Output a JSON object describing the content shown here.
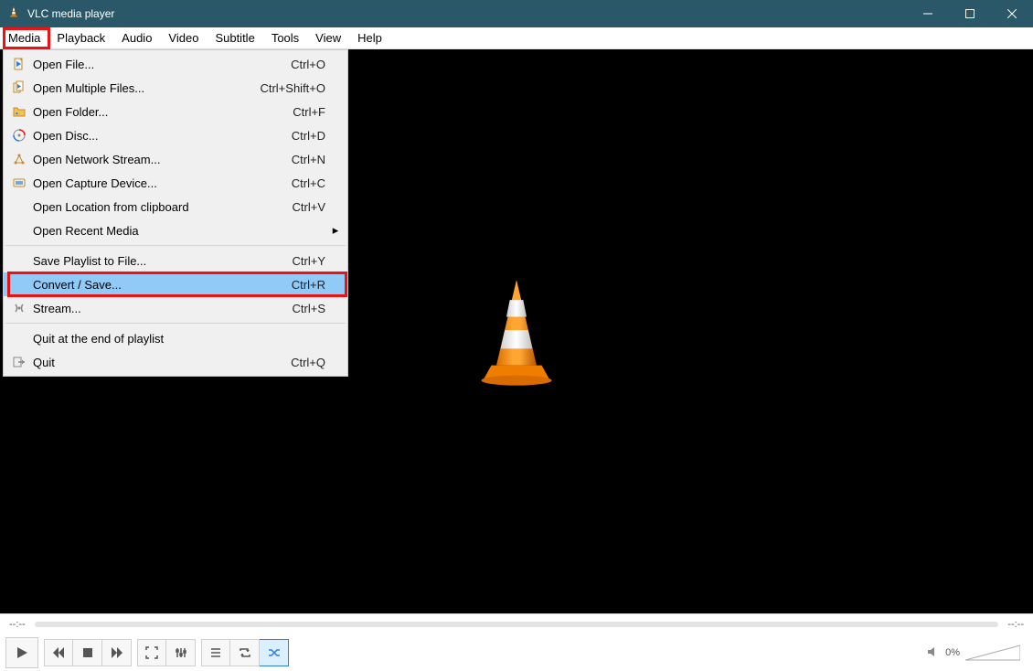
{
  "window": {
    "title": "VLC media player"
  },
  "menubar": {
    "items": [
      "Media",
      "Playback",
      "Audio",
      "Video",
      "Subtitle",
      "Tools",
      "View",
      "Help"
    ],
    "activeIndex": 0
  },
  "mediaMenu": {
    "groups": [
      [
        {
          "icon": "file-icon",
          "label": "Open File...",
          "shortcut": "Ctrl+O",
          "submenu": false
        },
        {
          "icon": "files-icon",
          "label": "Open Multiple Files...",
          "shortcut": "Ctrl+Shift+O",
          "submenu": false
        },
        {
          "icon": "folder-icon",
          "label": "Open Folder...",
          "shortcut": "Ctrl+F",
          "submenu": false
        },
        {
          "icon": "disc-icon",
          "label": "Open Disc...",
          "shortcut": "Ctrl+D",
          "submenu": false
        },
        {
          "icon": "network-icon",
          "label": "Open Network Stream...",
          "shortcut": "Ctrl+N",
          "submenu": false
        },
        {
          "icon": "capture-icon",
          "label": "Open Capture Device...",
          "shortcut": "Ctrl+C",
          "submenu": false
        },
        {
          "icon": "",
          "label": "Open Location from clipboard",
          "shortcut": "Ctrl+V",
          "submenu": false
        },
        {
          "icon": "",
          "label": "Open Recent Media",
          "shortcut": "",
          "submenu": true
        }
      ],
      [
        {
          "icon": "",
          "label": "Save Playlist to File...",
          "shortcut": "Ctrl+Y",
          "submenu": false
        },
        {
          "icon": "",
          "label": "Convert / Save...",
          "shortcut": "Ctrl+R",
          "submenu": false,
          "highlighted": true,
          "hover": true
        },
        {
          "icon": "stream-icon",
          "label": "Stream...",
          "shortcut": "Ctrl+S",
          "submenu": false
        }
      ],
      [
        {
          "icon": "",
          "label": "Quit at the end of playlist",
          "shortcut": "",
          "submenu": false
        },
        {
          "icon": "quit-icon",
          "label": "Quit",
          "shortcut": "Ctrl+Q",
          "submenu": false
        }
      ]
    ]
  },
  "seek": {
    "elapsed": "--:--",
    "remaining": "--:--"
  },
  "volume": {
    "percent": "0%"
  },
  "controls": {
    "play": "play-icon",
    "prev": "previous-icon",
    "stop": "stop-icon",
    "next": "next-icon",
    "fullscreen": "fullscreen-icon",
    "extended": "equalizer-icon",
    "playlist": "playlist-icon",
    "loop": "loop-icon",
    "shuffle": "shuffle-icon"
  }
}
